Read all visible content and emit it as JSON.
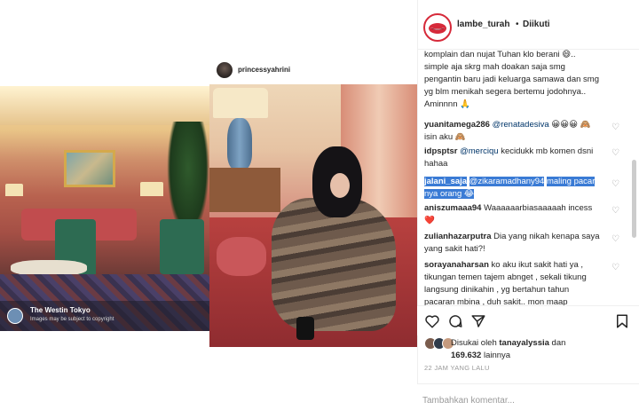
{
  "header": {
    "author": "lambe_turah",
    "separator": "•",
    "follow_status": "Diikuti"
  },
  "repost": {
    "username": "princessyahrini",
    "place_title": "The Westin Tokyo",
    "place_subtitle": "Images may be subject to copyright"
  },
  "comments": [
    {
      "user": "",
      "text": "komplain dan nujat Tuhan klo berani 😄.. simple aja skrg mah doakan saja smg pengantin baru jadi keluarga samawa dan smg yg blm menikah segera bertemu jodohnya.. Aminnnn 🙏"
    },
    {
      "user": "yuanitamega286",
      "mention": "@renatadesiva",
      "text": "😀😀😀 🙈 isin aku 🙈"
    },
    {
      "user": "idpsptsr",
      "mention": "@merciqu",
      "text": "kecidukk mb komen dsni hahaa"
    },
    {
      "user": "jalani_saja",
      "mention": "@zikaramadhany94",
      "text": "maling pacar nya orang 😂"
    },
    {
      "user": "aniszumaaa94",
      "text": "Waaaaaarbiasaaaaah incess❤️"
    },
    {
      "user": "zulianhazarputra",
      "text": "Dia yang nikah kenapa saya yang sakit hati?!"
    },
    {
      "user": "sorayanaharsan",
      "text": "ko aku ikut sakit hati ya , tikungan temen tajem abnget , sekali tikung langsung dinikahin , yg bertahun tahun pacaran mbina , duh sakit.. mon maap"
    }
  ],
  "likes": {
    "prefix": "Disukai oleh",
    "user": "tanayalyssia",
    "middle": "dan",
    "count": "169.632",
    "suffix": "lainnya"
  },
  "timestamp": "22 JAM YANG LALU",
  "comment_input": {
    "placeholder": "Tambahkan komentar..."
  },
  "icons": {
    "like": "heart-icon",
    "comment": "comment-icon",
    "share": "share-icon",
    "save": "bookmark-icon"
  },
  "colors": {
    "selection": "#3a7bd5",
    "mention": "#003569",
    "avatar_ring": "#d62a3a"
  }
}
